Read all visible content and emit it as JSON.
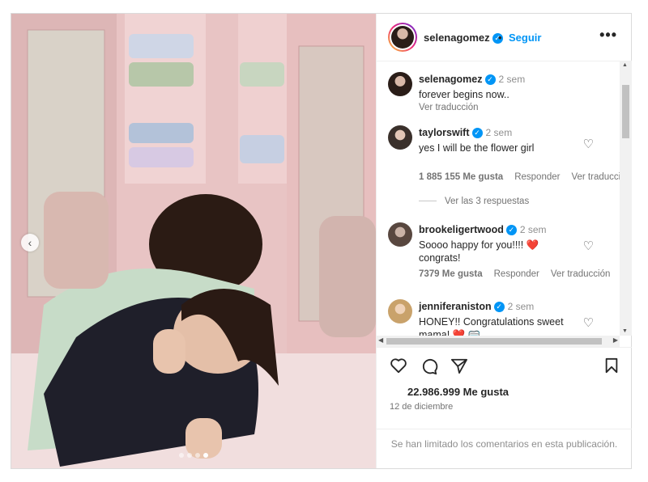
{
  "post": {
    "username": "selenagomez",
    "follow_label": "Seguir",
    "separator": "•",
    "more_label": "•••"
  },
  "caption": {
    "username": "selenagomez",
    "time": "2 sem",
    "text": "forever begins now..",
    "translate": "Ver traducción"
  },
  "comments": [
    {
      "username": "taylorswift",
      "time": "2 sem",
      "text": "yes I will be the flower girl",
      "likes": "1 885 155 Me gusta",
      "reply": "Responder",
      "translate": "Ver traducción",
      "replies": "Ver las 3 respuestas"
    },
    {
      "username": "brookeligertwood",
      "time": "2 sem",
      "text": "Soooo happy for you!!!! ❤️ congrats!",
      "likes": "7379 Me gusta",
      "reply": "Responder",
      "translate": "Ver traducción"
    },
    {
      "username": "jenniferaniston",
      "time": "2 sem",
      "text": "HONEY!! Congratulations sweet mama! ❤️ 🥽"
    }
  ],
  "likes_total": "22.986.999 Me gusta",
  "date": "12 de diciembre",
  "limited_notice": "Se han limitado los comentarios en esta publicación.",
  "colors": {
    "accent": "#0095f6",
    "heart_red": "#ed4956",
    "text": "#262626",
    "muted": "#737373"
  },
  "icons": [
    "chevron-left-icon",
    "verified-icon",
    "more-icon",
    "heart-icon",
    "comment-icon",
    "share-icon",
    "bookmark-icon"
  ]
}
